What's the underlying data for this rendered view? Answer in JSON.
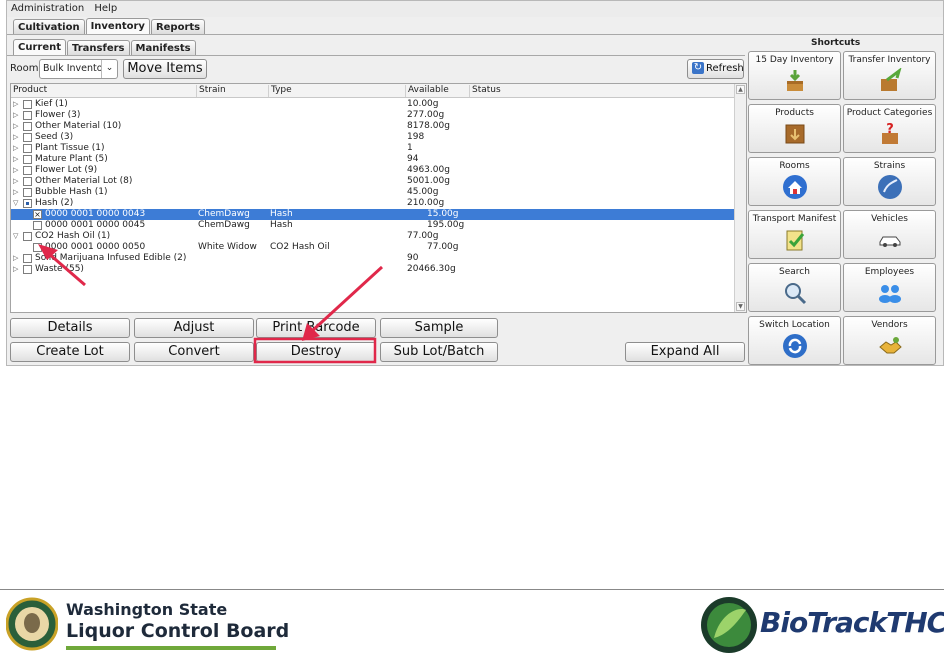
{
  "menubar": {
    "items": [
      "Administration",
      "Help"
    ]
  },
  "top_tabs": [
    "Cultivation",
    "Inventory",
    "Reports"
  ],
  "top_tab_active": "Inventory",
  "sub_tabs": [
    "Current",
    "Transfers",
    "Manifests"
  ],
  "sub_tab_active": "Current",
  "room_bar": {
    "label": "Room",
    "room_value": "Bulk Inventory",
    "move_items": "Move Items",
    "refresh": "Refresh"
  },
  "table": {
    "headers": [
      "Product",
      "Strain",
      "Type",
      "Available",
      "Status"
    ],
    "rows": [
      {
        "product": "Kief (1)",
        "strain": "",
        "type": "",
        "available": "10.00g",
        "level": 0,
        "expander": "closed",
        "check": "none",
        "selected": false
      },
      {
        "product": "Flower (3)",
        "strain": "",
        "type": "",
        "available": "277.00g",
        "level": 0,
        "expander": "closed",
        "check": "none",
        "selected": false
      },
      {
        "product": "Other Material (10)",
        "strain": "",
        "type": "",
        "available": "8178.00g",
        "level": 0,
        "expander": "closed",
        "check": "none",
        "selected": false
      },
      {
        "product": "Seed (3)",
        "strain": "",
        "type": "",
        "available": "198",
        "level": 0,
        "expander": "closed",
        "check": "none",
        "selected": false
      },
      {
        "product": "Plant Tissue (1)",
        "strain": "",
        "type": "",
        "available": "1",
        "level": 0,
        "expander": "closed",
        "check": "none",
        "selected": false
      },
      {
        "product": "Mature Plant (5)",
        "strain": "",
        "type": "",
        "available": "94",
        "level": 0,
        "expander": "closed",
        "check": "none",
        "selected": false
      },
      {
        "product": "Flower Lot (9)",
        "strain": "",
        "type": "",
        "available": "4963.00g",
        "level": 0,
        "expander": "closed",
        "check": "none",
        "selected": false
      },
      {
        "product": "Other Material Lot (8)",
        "strain": "",
        "type": "",
        "available": "5001.00g",
        "level": 0,
        "expander": "closed",
        "check": "none",
        "selected": false
      },
      {
        "product": "Bubble Hash (1)",
        "strain": "",
        "type": "",
        "available": "45.00g",
        "level": 0,
        "expander": "closed",
        "check": "none",
        "selected": false
      },
      {
        "product": "Hash (2)",
        "strain": "",
        "type": "",
        "available": "210.00g",
        "level": 0,
        "expander": "open",
        "check": "partial",
        "selected": false
      },
      {
        "product": "0000 0001 0000 0043",
        "strain": "ChemDawg",
        "type": "Hash",
        "available": "15.00g",
        "level": 1,
        "expander": "none",
        "check": "checked",
        "selected": true
      },
      {
        "product": "0000 0001 0000 0045",
        "strain": "ChemDawg",
        "type": "Hash",
        "available": "195.00g",
        "level": 1,
        "expander": "none",
        "check": "none",
        "selected": false
      },
      {
        "product": "CO2 Hash Oil (1)",
        "strain": "",
        "type": "",
        "available": "77.00g",
        "level": 0,
        "expander": "open",
        "check": "none",
        "selected": false
      },
      {
        "product": "0000 0001 0000 0050",
        "strain": "White Widow",
        "type": "CO2 Hash Oil",
        "available": "77.00g",
        "level": 1,
        "expander": "none",
        "check": "none",
        "selected": false
      },
      {
        "product": "Solid Marijuana Infused Edible (2)",
        "strain": "",
        "type": "",
        "available": "90",
        "level": 0,
        "expander": "closed",
        "check": "none",
        "selected": false
      },
      {
        "product": "Waste (55)",
        "strain": "",
        "type": "",
        "available": "20466.30g",
        "level": 0,
        "expander": "closed",
        "check": "none",
        "selected": false
      }
    ]
  },
  "actions": {
    "details": "Details",
    "adjust": "Adjust",
    "print_barcode": "Print Barcode",
    "sample": "Sample",
    "create_lot": "Create Lot",
    "convert": "Convert",
    "destroy": "Destroy",
    "sub_lot": "Sub Lot/Batch",
    "expand_all": "Expand All"
  },
  "shortcuts": {
    "title": "Shortcuts",
    "items": [
      {
        "label": "15 Day Inventory",
        "icon": "download-box-icon"
      },
      {
        "label": "Transfer Inventory",
        "icon": "transfer-box-icon"
      },
      {
        "label": "Products",
        "icon": "products-box-icon"
      },
      {
        "label": "Product Categories",
        "icon": "category-box-icon"
      },
      {
        "label": "Rooms",
        "icon": "rooms-house-icon"
      },
      {
        "label": "Strains",
        "icon": "strains-globe-icon"
      },
      {
        "label": "Transport Manifest",
        "icon": "manifest-clipboard-icon"
      },
      {
        "label": "Vehicles",
        "icon": "vehicle-car-icon"
      },
      {
        "label": "Search",
        "icon": "search-magnifier-icon"
      },
      {
        "label": "Employees",
        "icon": "employees-people-icon"
      },
      {
        "label": "Switch Location",
        "icon": "switch-location-icon"
      },
      {
        "label": "Vendors",
        "icon": "vendors-handshake-icon"
      }
    ]
  },
  "footer": {
    "agency_line1": "Washington State",
    "agency_line2": "Liquor Control Board",
    "brand": "BioTrackTHC"
  },
  "colors": {
    "selection": "#3d7cd6",
    "annotation_arrow": "#e0284a",
    "brand_green": "#6fa83a"
  }
}
